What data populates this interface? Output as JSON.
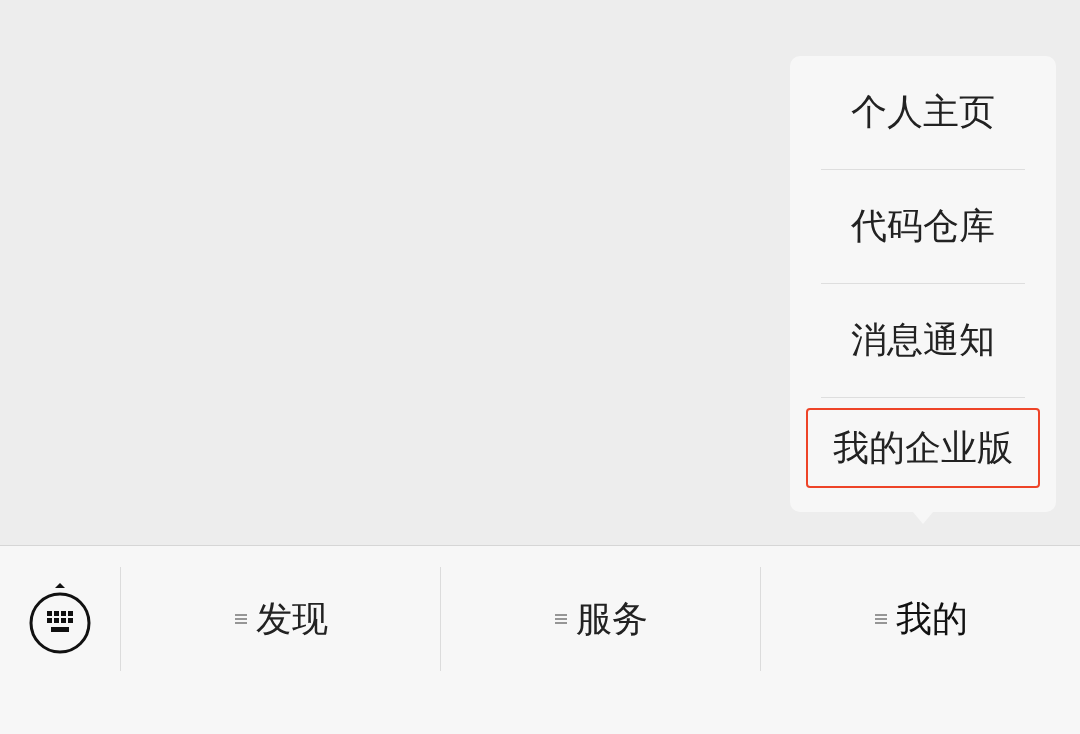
{
  "menu_bar": {
    "tabs": [
      {
        "label": "发现",
        "expanded": false
      },
      {
        "label": "服务",
        "expanded": false
      },
      {
        "label": "我的",
        "expanded": true,
        "submenu": [
          {
            "label": "个人主页",
            "highlighted": false
          },
          {
            "label": "代码仓库",
            "highlighted": false
          },
          {
            "label": "消息通知",
            "highlighted": false
          },
          {
            "label": "我的企业版",
            "highlighted": true
          }
        ]
      }
    ]
  }
}
